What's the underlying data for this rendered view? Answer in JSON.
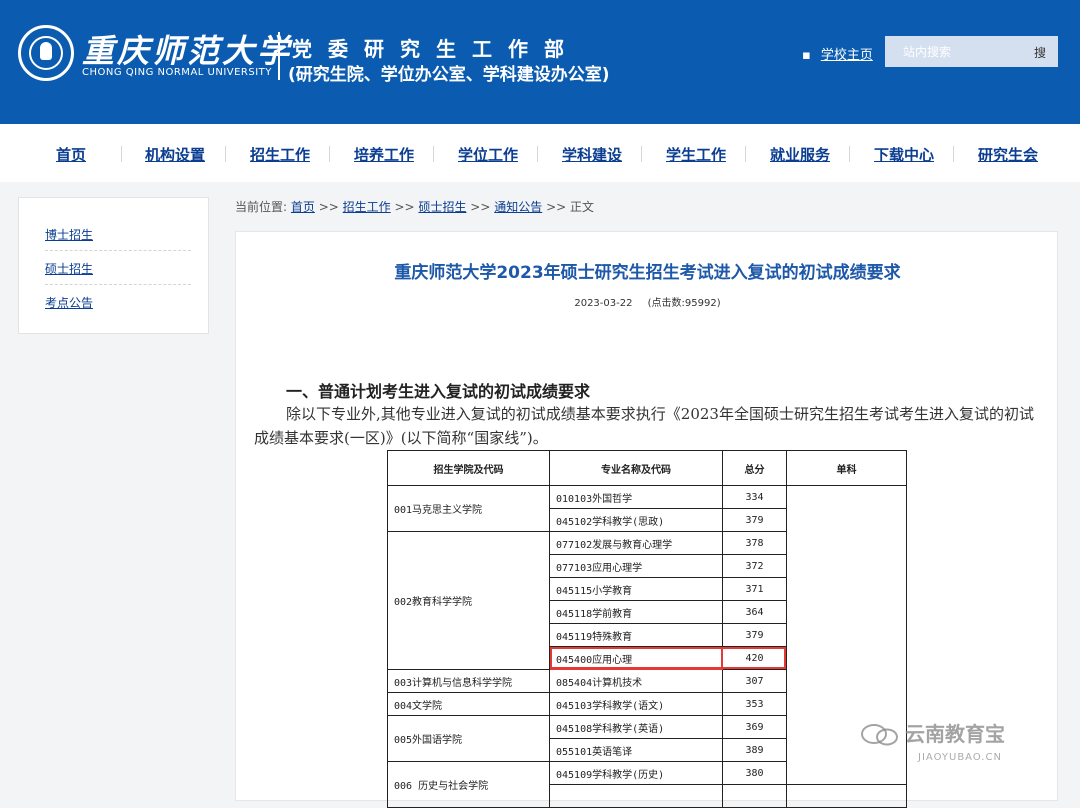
{
  "header": {
    "logo_cn": "重庆师范大学",
    "logo_en": "CHONG QING NORMAL UNIVERSITY",
    "dept_line1": "党委研究生工作部",
    "dept_line2": "(研究生院、学位办公室、学科建设办公室)",
    "home_link": "学校主页",
    "search_placeholder": "站内搜索",
    "search_button": "搜"
  },
  "nav": [
    "首页",
    "机构设置",
    "招生工作",
    "培养工作",
    "学位工作",
    "学科建设",
    "学生工作",
    "就业服务",
    "下载中心",
    "研究生会"
  ],
  "sidebar": [
    "博士招生",
    "硕士招生",
    "考点公告"
  ],
  "breadcrumb": {
    "prefix": "当前位置:",
    "items": [
      "首页",
      "招生工作",
      "硕士招生",
      "通知公告"
    ],
    "sep": ">>",
    "current": "正文"
  },
  "article": {
    "title": "重庆师范大学2023年硕士研究生招生考试进入复试的初试成绩要求",
    "date": "2023-03-22",
    "clicks": "(点击数:95992)",
    "section_heading": "一、普通计划考生进入复试的初试成绩要求",
    "paragraph": "除以下专业外,其他专业进入复试的初试成绩基本要求执行《2023年全国硕士研究生招生考试考生进入复试的初试成绩基本要求(一区)》(以下简称“国家线”)。"
  },
  "table": {
    "headers": [
      "招生学院及代码",
      "专业名称及代码",
      "总分",
      "单科"
    ],
    "groups": [
      {
        "college": "001马克思主义学院",
        "rows": [
          [
            "010103外国哲学",
            "334"
          ],
          [
            "045102学科教学(思政)",
            "379"
          ]
        ]
      },
      {
        "college": "002教育科学学院",
        "rows": [
          [
            "077102发展与教育心理学",
            "378"
          ],
          [
            "077103应用心理学",
            "372"
          ],
          [
            "045115小学教育",
            "371"
          ],
          [
            "045118学前教育",
            "364"
          ],
          [
            "045119特殊教育",
            "379"
          ],
          [
            "045400应用心理",
            "420"
          ]
        ]
      },
      {
        "college": "003计算机与信息科学学院",
        "rows": [
          [
            "085404计算机技术",
            "307"
          ]
        ]
      },
      {
        "college": "004文学院",
        "rows": [
          [
            "045103学科教学(语文)",
            "353"
          ]
        ]
      },
      {
        "college": "005外国语学院",
        "rows": [
          [
            "045108学科教学(英语)",
            "369"
          ],
          [
            "055101英语笔译",
            "389"
          ]
        ]
      },
      {
        "college": "006 历史与社会学院",
        "rows": [
          [
            "045109学科教学(历史)",
            "380"
          ]
        ]
      }
    ],
    "highlight_color": "#e53935"
  },
  "watermark": {
    "text": "云南教育宝",
    "sub": "JIAOYUBAO.CN"
  },
  "colors": {
    "header_bg": "#0b5cb0",
    "title": "#1e58a8",
    "link": "#0b3d91"
  }
}
